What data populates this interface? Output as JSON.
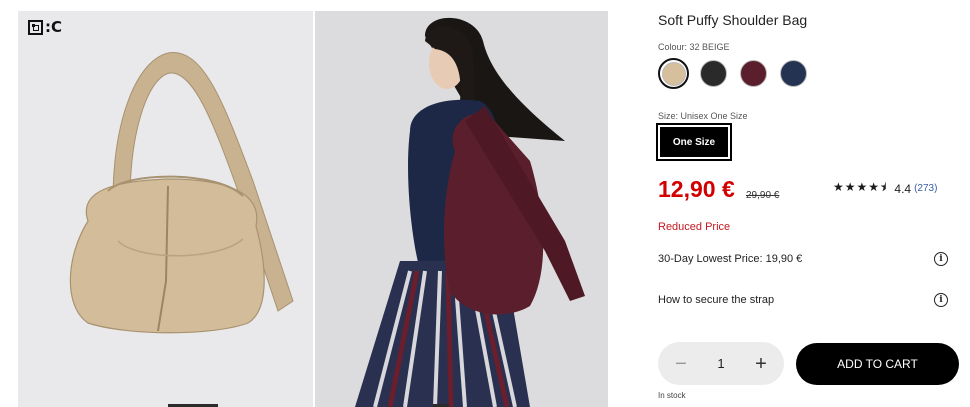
{
  "gallery": {
    "brand_logo_text": ":C"
  },
  "product": {
    "title": "Soft Puffy Shoulder Bag",
    "colour_label": "Colour: 32 BEIGE",
    "colours": [
      {
        "name": "beige",
        "hex": "#d6bf9d",
        "selected": true
      },
      {
        "name": "black",
        "hex": "#2a2a2a",
        "selected": false
      },
      {
        "name": "wine",
        "hex": "#5a1e2c",
        "selected": false
      },
      {
        "name": "navy",
        "hex": "#243352",
        "selected": false
      }
    ],
    "size_label": "Size: Unisex One Size",
    "size_option": "One Size",
    "price": "12,90 €",
    "old_price": "29,90 €",
    "rating": {
      "stars": "★★★★⯨",
      "value": "4.4",
      "count": "(273)"
    },
    "reduced_label": "Reduced Price",
    "lowest_price": "30-Day Lowest Price: 19,90 €",
    "strap_help": "How to secure the strap",
    "quantity": {
      "minus": "−",
      "value": "1",
      "plus": "+"
    },
    "add_to_cart": "ADD TO CART",
    "stock": "In stock"
  },
  "colors": {
    "price_red": "#d20000",
    "reduced_red": "#c2181f",
    "rating_blue": "#3a5fa8"
  }
}
